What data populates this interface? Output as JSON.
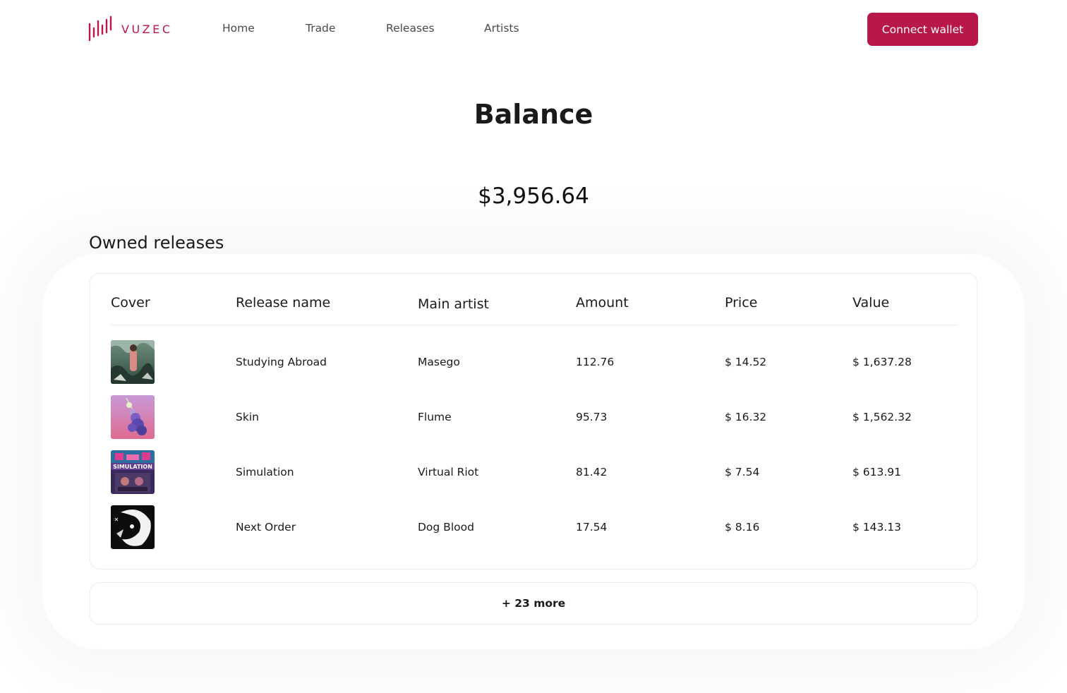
{
  "brand": {
    "name": "VUZEC",
    "color": "#b8174a"
  },
  "nav": {
    "items": [
      {
        "label": "Home"
      },
      {
        "label": "Trade"
      },
      {
        "label": "Releases"
      },
      {
        "label": "Artists"
      }
    ],
    "connect_label": "Connect wallet"
  },
  "balance": {
    "title": "Balance",
    "amount": "$3,956.64"
  },
  "owned": {
    "title": "Owned releases",
    "columns": [
      "Cover",
      "Release name",
      "Main artist",
      "Amount",
      "Price",
      "Value"
    ],
    "rows": [
      {
        "cover": "studying-abroad-cover",
        "name": "Studying Abroad",
        "artist": "Masego",
        "amount": "112.76",
        "price": "$ 14.52",
        "value": "$ 1,637.28"
      },
      {
        "cover": "skin-cover",
        "name": "Skin",
        "artist": "Flume",
        "amount": "95.73",
        "price": "$ 16.32",
        "value": "$ 1,562.32"
      },
      {
        "cover": "simulation-cover",
        "name": "Simulation",
        "artist": "Virtual Riot",
        "amount": "81.42",
        "price": "$ 7.54",
        "value": "$ 613.91"
      },
      {
        "cover": "next-order-cover",
        "name": "Next Order",
        "artist": "Dog Blood",
        "amount": "17.54",
        "price": "$ 8.16",
        "value": "$ 143.13"
      }
    ],
    "more_label": "+ 23 more"
  }
}
